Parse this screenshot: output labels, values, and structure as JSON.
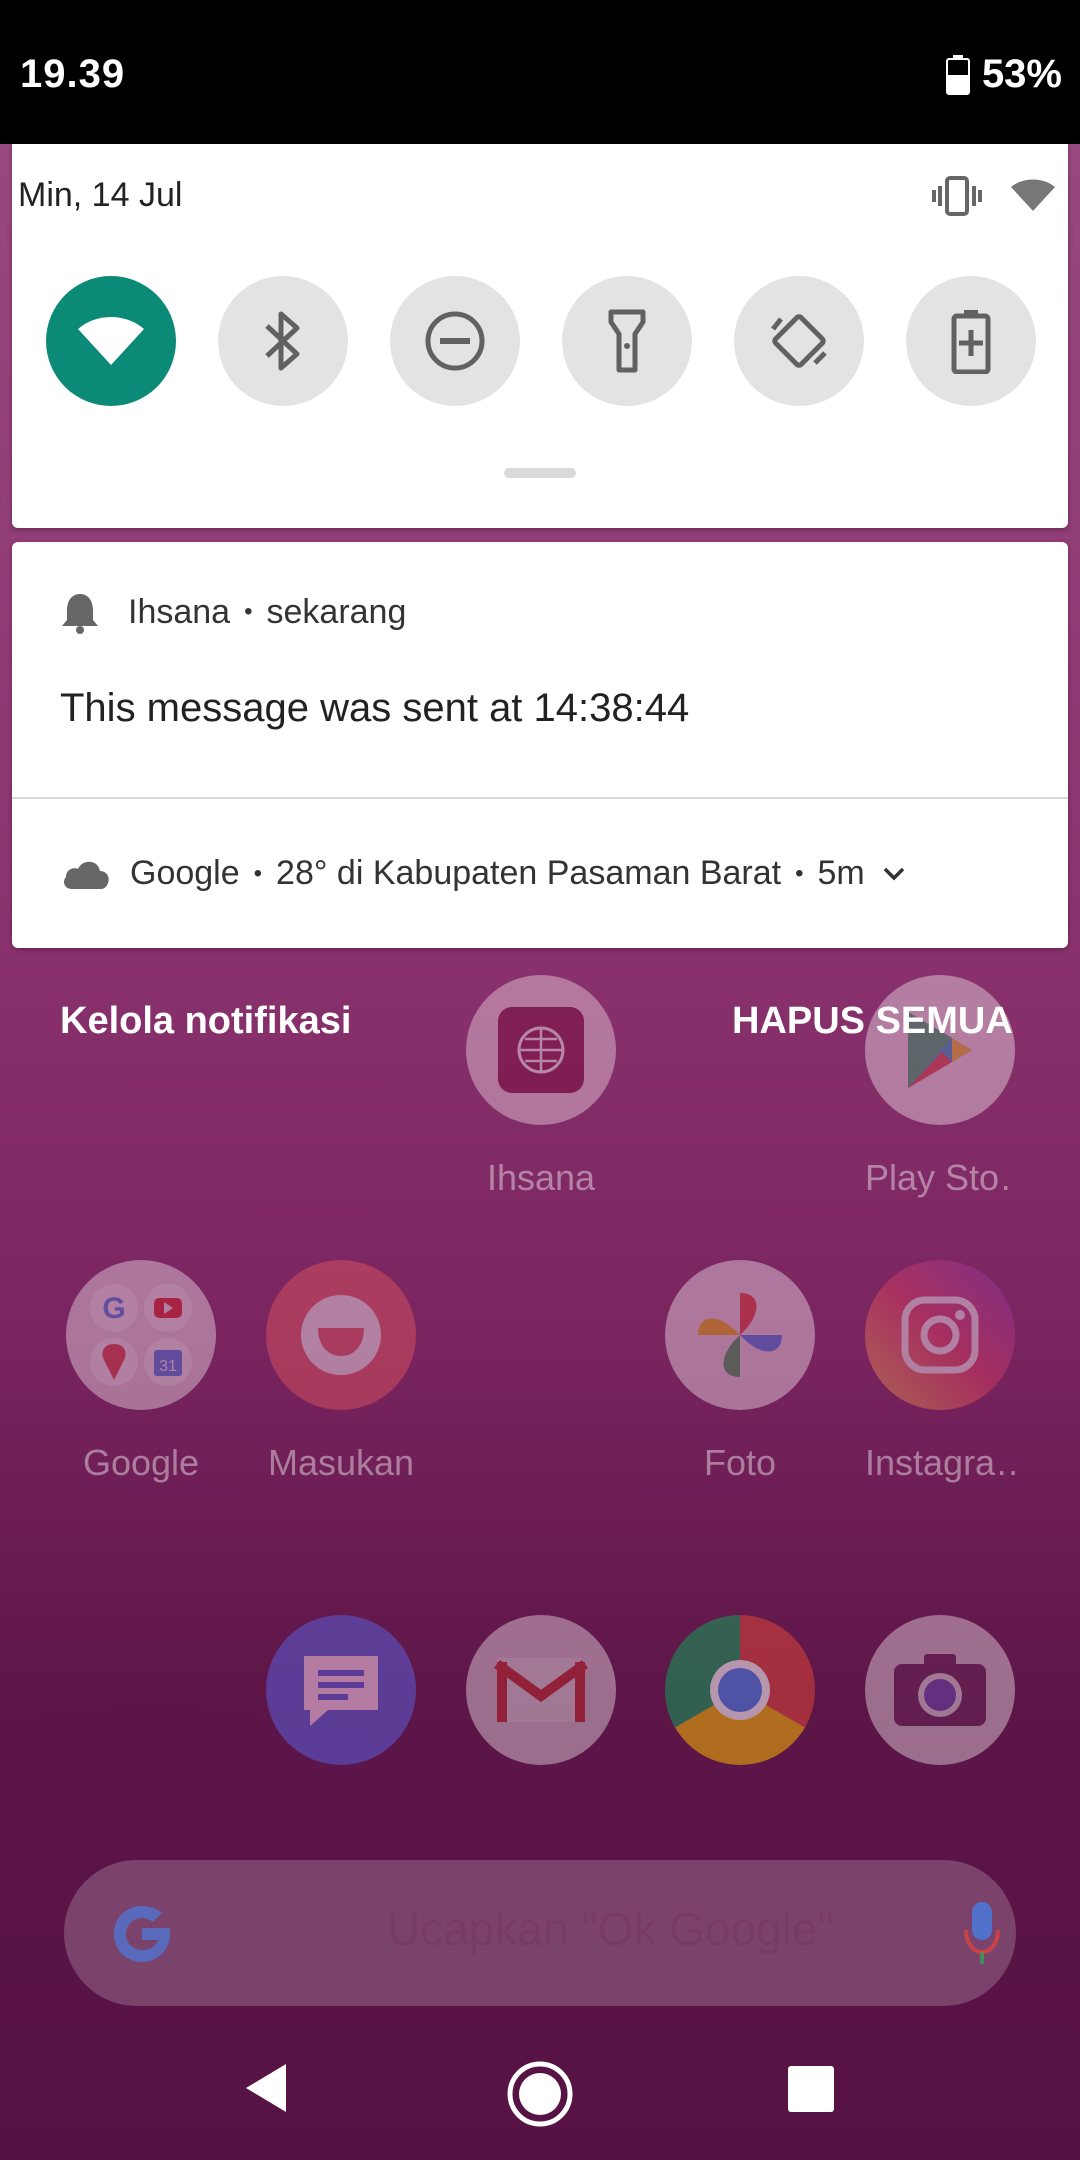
{
  "status_bar": {
    "time": "19.39",
    "battery_level": "53%"
  },
  "quick_settings": {
    "date": "Min, 14 Jul",
    "tiles": [
      {
        "name": "wifi",
        "active": true
      },
      {
        "name": "bluetooth",
        "active": false
      },
      {
        "name": "do-not-disturb",
        "active": false
      },
      {
        "name": "flashlight",
        "active": false
      },
      {
        "name": "auto-rotate",
        "active": false
      },
      {
        "name": "battery-saver",
        "active": false
      }
    ],
    "accent": "#0c8a78"
  },
  "notifications": [
    {
      "app": "Ihsana",
      "time": "sekarang",
      "message": "This message was sent at 14:38:44"
    },
    {
      "app": "Google",
      "summary": "28° di Kabupaten Pasaman Barat",
      "time": "5m"
    }
  ],
  "actions": {
    "manage": "Kelola notifikasi",
    "clear_all": "HAPUS SEMUA"
  },
  "home": {
    "apps_row1": [
      {
        "label": "Ihsana"
      },
      {
        "label": "Play Sto…"
      }
    ],
    "apps_row2": [
      {
        "label": "Google"
      },
      {
        "label": "Masukan"
      },
      {
        "label": "Foto"
      },
      {
        "label": "Instagra…"
      }
    ],
    "search_hint": "Ucapkan \"Ok Google\""
  }
}
